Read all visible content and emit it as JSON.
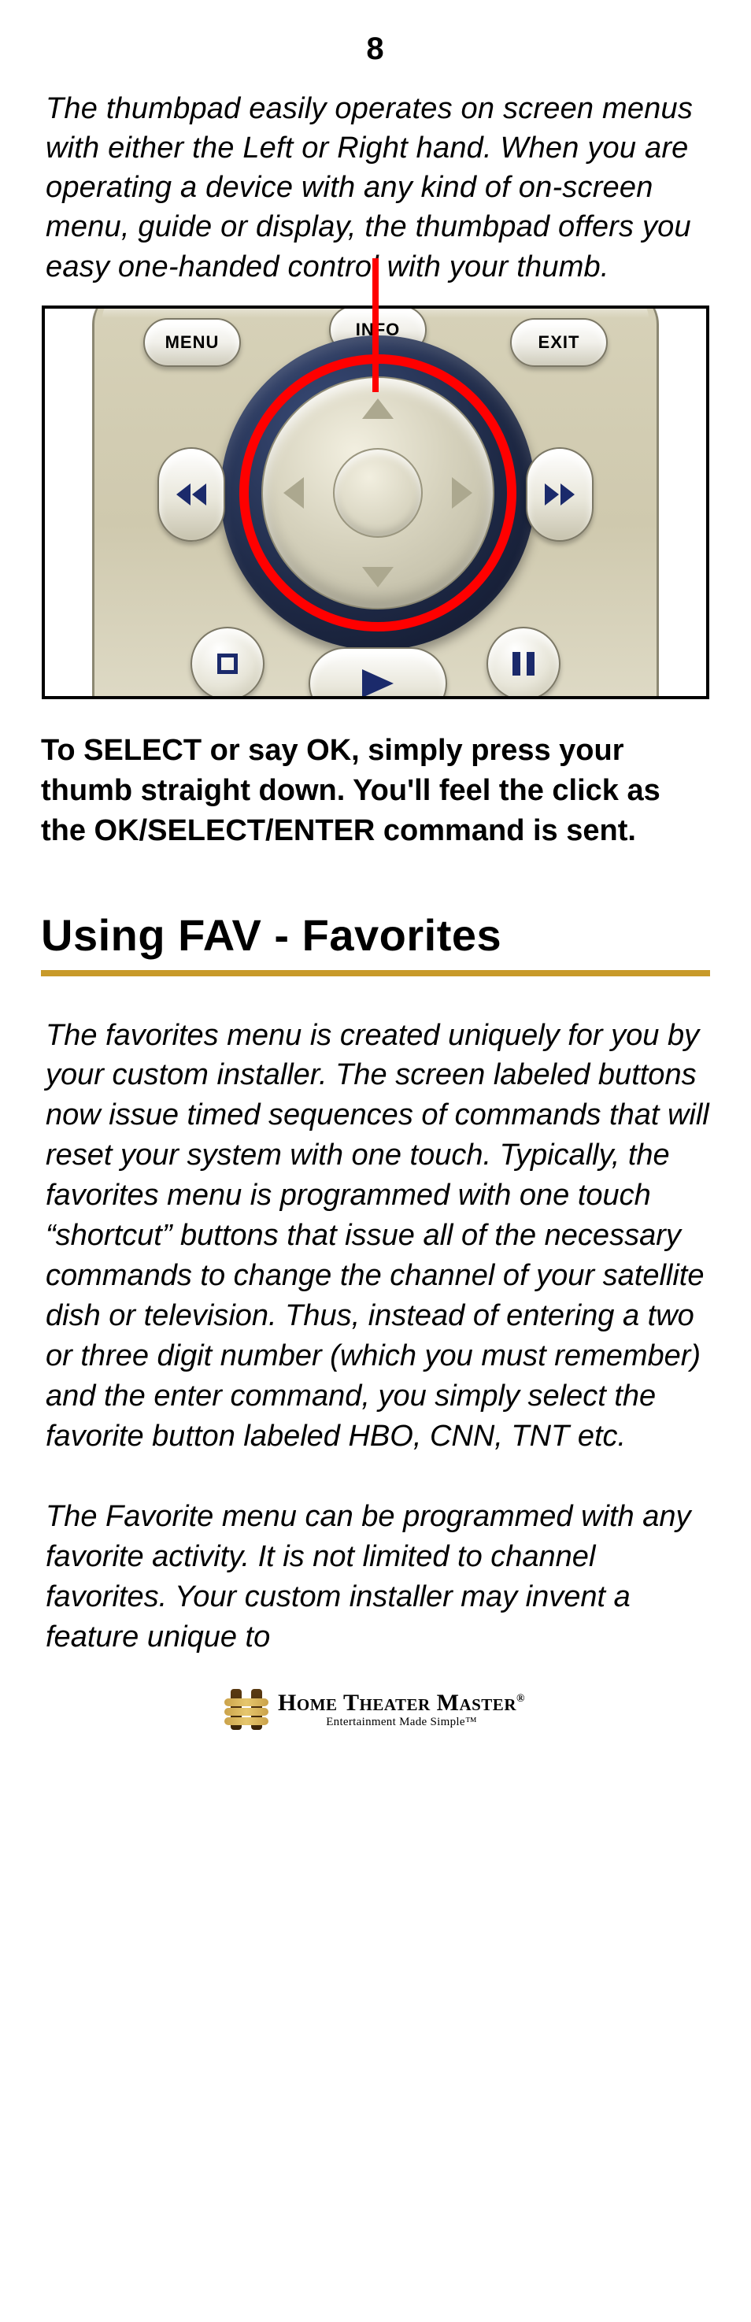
{
  "page_number": "8",
  "intro_paragraph": "The thumbpad easily operates on screen menus with either the Left or Right hand. When you are operating a device with any kind of on-screen menu, guide or display, the thumbpad offers you easy one-handed control with your thumb.",
  "remote": {
    "menu_label": "MENU",
    "info_label": "INFO",
    "exit_label": "EXIT"
  },
  "select_paragraph": "To SELECT or say OK, simply press your thumb straight down. You'll feel the click as the OK/SELECT/ENTER command is sent.",
  "section_heading": "Using FAV - Favorites",
  "fav_paragraph_1": "The favorites menu is created uniquely for you by your custom installer. The screen labeled buttons now issue timed sequences of commands that will reset your system with one touch. Typically, the favorites menu is pro­grammed with one touch “shortcut” buttons that issue all of the necessary commands to change the channel of your satellite dish or television. Thus, instead of entering a two or three digit number (which you must remember) and the enter command, you simply select the favorite button labeled HBO, CNN, TNT etc.",
  "fav_paragraph_2": "The Favorite menu can be programmed with any favorite activity. It is not limited to channel favorites. Your custom installer may invent a feature unique to",
  "footer": {
    "brand_main": "Home Theater Master",
    "brand_tag": "Entertainment Made Simple",
    "tm": "™",
    "reg": "®"
  }
}
